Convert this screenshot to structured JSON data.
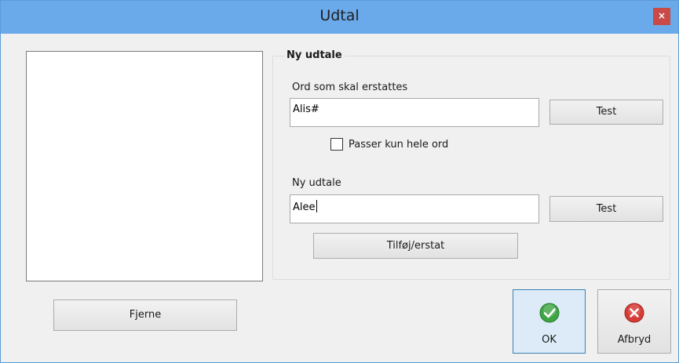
{
  "window": {
    "title": "Udtal",
    "close_glyph": "×"
  },
  "list": {
    "items": []
  },
  "group": {
    "title": "Ny udtale",
    "word_label": "Ord som skal erstattes",
    "word_value": "Alis#",
    "test_label_1": "Test",
    "whole_word_label": "Passer kun hele ord",
    "whole_word_checked": false,
    "pron_label": "Ny udtale",
    "pron_value": "Alee",
    "test_label_2": "Test",
    "add_label": "Tilføj/erstat"
  },
  "buttons": {
    "remove_label": "Fjerne",
    "ok_label": "OK",
    "cancel_label": "Afbryd"
  },
  "icons": {
    "ok": "checkmark-circle-icon",
    "cancel": "x-circle-icon"
  },
  "colors": {
    "titlebar": "#6aaaea",
    "close": "#c94a47",
    "ok_icon": "#3fa544",
    "cancel_icon": "#d63b34"
  }
}
